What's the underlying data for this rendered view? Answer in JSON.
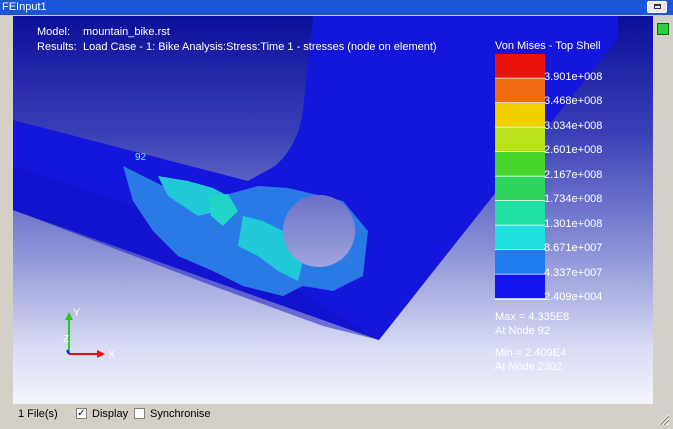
{
  "window": {
    "title": "FEInput1"
  },
  "header": {
    "model_label": "Model:",
    "model_value": "mountain_bike.rst",
    "results_label": "Results:",
    "results_value": "Load Case - 1: Bike Analysis:Stress:Time 1 - stresses (node on element)"
  },
  "node_label": "92",
  "legend": {
    "title": "Von Mises - Top Shell",
    "bands": [
      "#e8140c",
      "#f06a10",
      "#f0d000",
      "#b8e21a",
      "#46d62c",
      "#2ed65e",
      "#1de0a2",
      "#20e0e0",
      "#1e7ef0",
      "#1414f2"
    ],
    "ticks": [
      "3.901e+008",
      "3.468e+008",
      "3.034e+008",
      "2.601e+008",
      "2.167e+008",
      "1.734e+008",
      "1.301e+008",
      "8.671e+007",
      "4.337e+007",
      "2.409e+004"
    ],
    "max_line": "Max = 4.335E8",
    "max_node": "At Node 92",
    "min_line": "Min = 2.409E4",
    "min_node": "At Node 2302"
  },
  "triad": {
    "y_label": "Y",
    "x_label": "X",
    "z_label": "Z"
  },
  "status": {
    "files_text": "1 File(s)",
    "display_label": "Display",
    "display_checked": true,
    "sync_label": "Synchronise",
    "sync_checked": false
  }
}
